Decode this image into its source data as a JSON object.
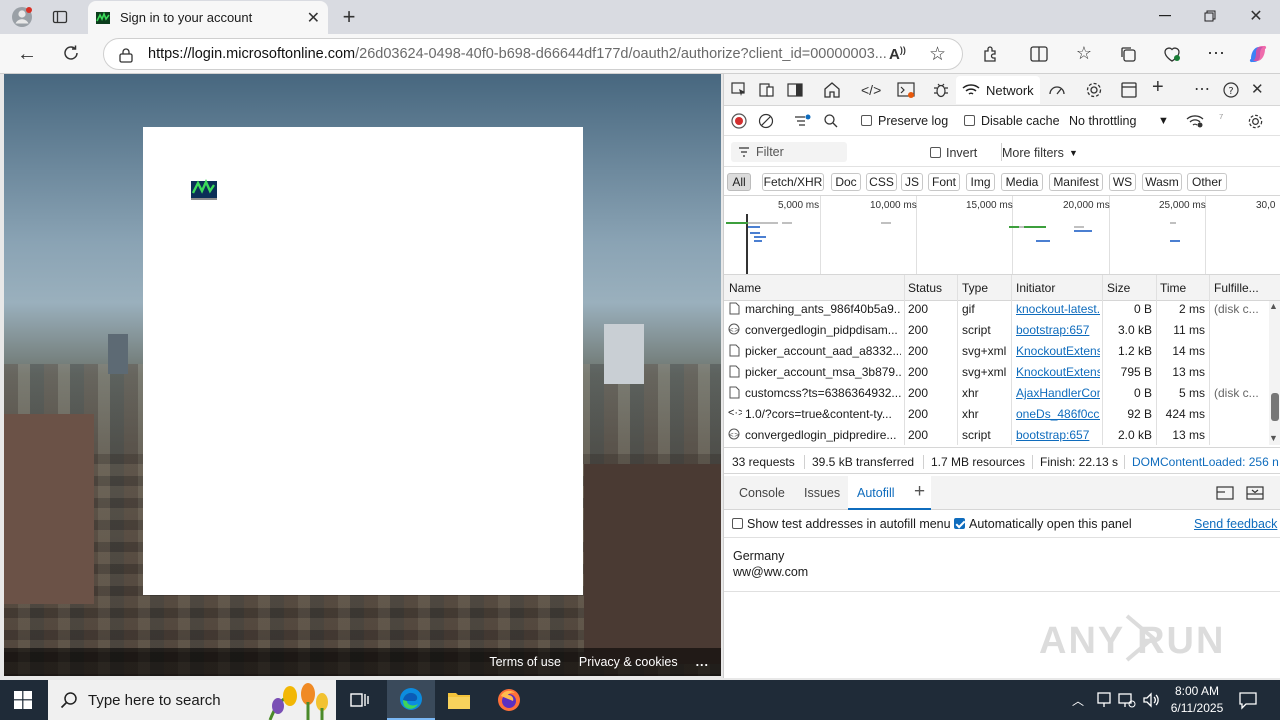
{
  "browser": {
    "tab_title": "Sign in to your account",
    "url_host": "https://login.microsoftonline.com",
    "url_path": "/26d03624-0498-40f0-b698-d66644df177d/oauth2/authorize?client_id=00000003..."
  },
  "page": {
    "footer": {
      "terms": "Terms of use",
      "privacy": "Privacy & cookies",
      "more": "..."
    }
  },
  "devtools": {
    "active_panel": "Network",
    "toolbar": {
      "preserve_log": "Preserve log",
      "disable_cache": "Disable cache",
      "throttling": "No throttling"
    },
    "filter": {
      "placeholder": "Filter",
      "invert": "Invert",
      "more_filters": "More filters"
    },
    "type_filters": [
      "All",
      "Fetch/XHR",
      "Doc",
      "CSS",
      "JS",
      "Font",
      "Img",
      "Media",
      "Manifest",
      "WS",
      "Wasm",
      "Other"
    ],
    "overview_labels": [
      "5,000 ms",
      "10,000 ms",
      "15,000 ms",
      "20,000 ms",
      "25,000 ms",
      "30,0"
    ],
    "columns": [
      "Name",
      "Status",
      "Type",
      "Initiator",
      "Size",
      "Time",
      "Fulfille..."
    ],
    "rows": [
      {
        "name": "marching_ants_986f40b5a9...",
        "status": "200",
        "type": "gif",
        "initiator": "knockout-latest.",
        "size": "0 B",
        "time": "2 ms",
        "fulfilled": "(disk c..."
      },
      {
        "name": "convergedlogin_pidpdisam...",
        "status": "200",
        "type": "script",
        "initiator": "bootstrap:657",
        "size": "3.0 kB",
        "time": "11 ms",
        "fulfilled": ""
      },
      {
        "name": "picker_account_aad_a8332...",
        "status": "200",
        "type": "svg+xml",
        "initiator": "KnockoutExtens",
        "size": "1.2 kB",
        "time": "14 ms",
        "fulfilled": ""
      },
      {
        "name": "picker_account_msa_3b879...",
        "status": "200",
        "type": "svg+xml",
        "initiator": "KnockoutExtens",
        "size": "795 B",
        "time": "13 ms",
        "fulfilled": ""
      },
      {
        "name": "customcss?ts=6386364932...",
        "status": "200",
        "type": "xhr",
        "initiator": "AjaxHandlerCon",
        "size": "0 B",
        "time": "5 ms",
        "fulfilled": "(disk c..."
      },
      {
        "name": "1.0/?cors=true&content-ty...",
        "status": "200",
        "type": "xhr",
        "initiator": "oneDs_486f0cc..",
        "size": "92 B",
        "time": "424 ms",
        "fulfilled": ""
      },
      {
        "name": "convergedlogin_pidpredire...",
        "status": "200",
        "type": "script",
        "initiator": "bootstrap:657",
        "size": "2.0 kB",
        "time": "13 ms",
        "fulfilled": ""
      }
    ],
    "summary": {
      "requests": "33 requests",
      "transferred": "39.5 kB transferred",
      "resources": "1.7 MB resources",
      "finish": "Finish: 22.13 s",
      "dcl": "DOMContentLoaded: 256 n"
    },
    "drawer": {
      "tabs": [
        "Console",
        "Issues",
        "Autofill"
      ],
      "active_tab": "Autofill",
      "show_test": "Show test addresses in autofill menu",
      "auto_open": "Automatically open this panel",
      "send_feedback": "Send feedback",
      "data": [
        "Germany",
        "ww@ww.com"
      ]
    }
  },
  "watermark": "ANY RUN",
  "taskbar": {
    "search_placeholder": "Type here to search",
    "time": "8:00 AM",
    "date": "6/11/2025"
  }
}
